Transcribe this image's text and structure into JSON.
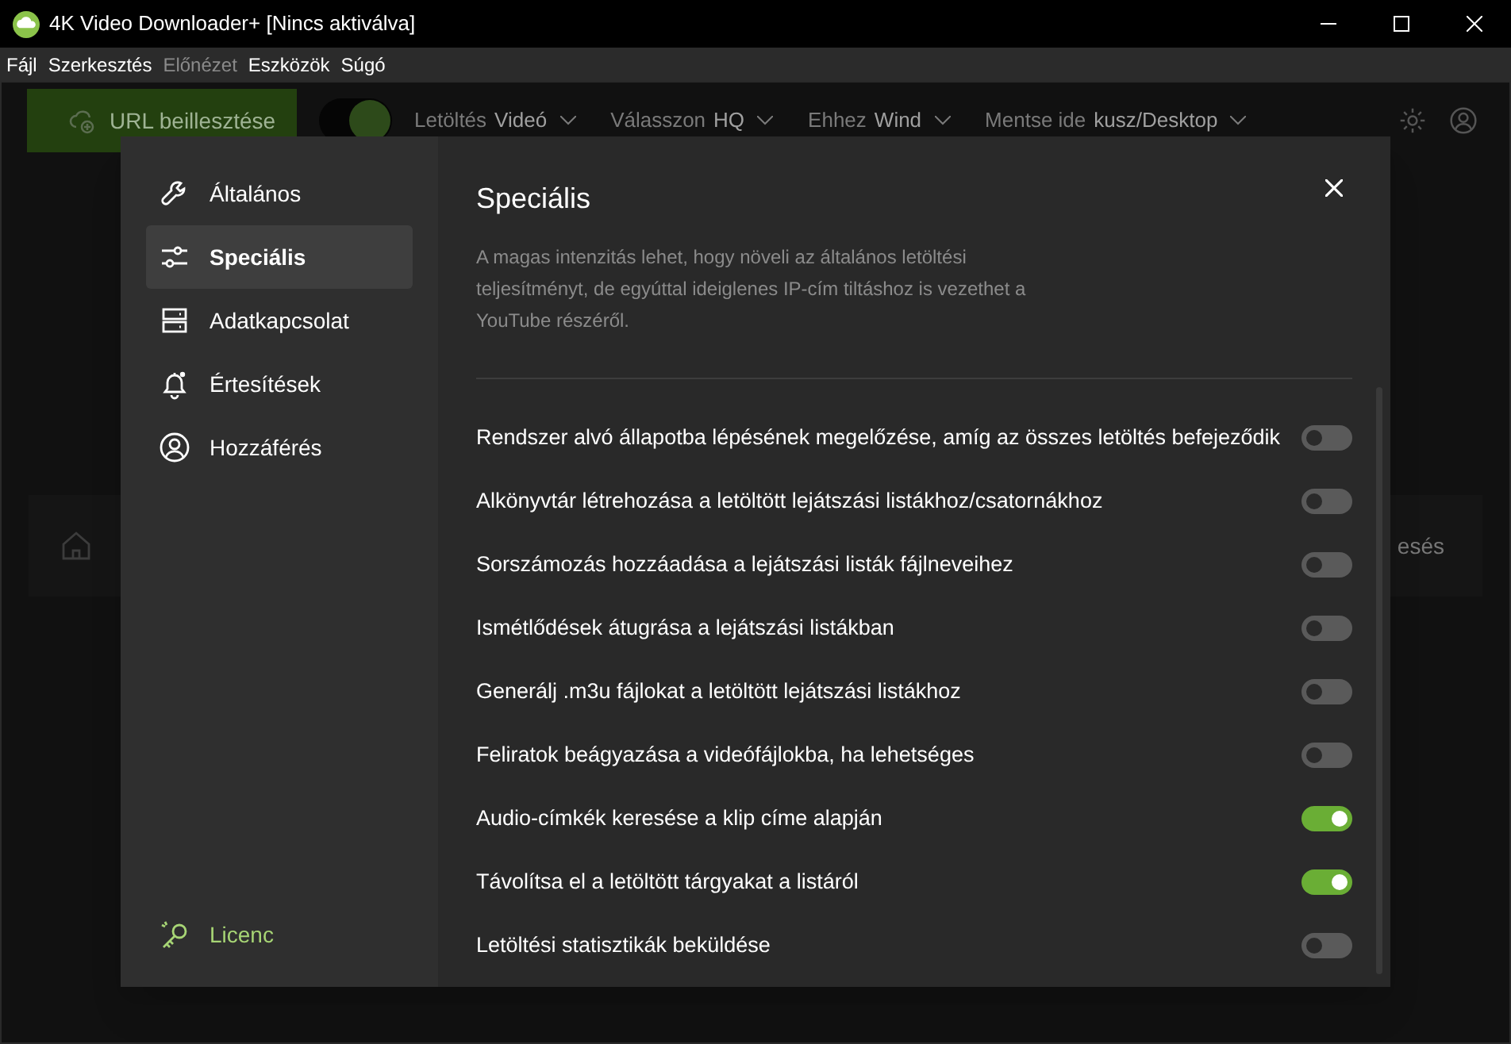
{
  "window": {
    "title": "4K Video Downloader+ [Nincs aktiválva]"
  },
  "menu": [
    {
      "label": "Fájl",
      "disabled": false
    },
    {
      "label": "Szerkesztés",
      "disabled": false
    },
    {
      "label": "Előnézet",
      "disabled": true
    },
    {
      "label": "Eszközök",
      "disabled": false
    },
    {
      "label": "Súgó",
      "disabled": false
    }
  ],
  "toolbar": {
    "paste_button": "URL beillesztése",
    "smart_mode": {
      "on": true
    },
    "options": [
      {
        "label": "Letöltés",
        "value": "Videó"
      },
      {
        "label": "Válasszon",
        "value": "HQ"
      },
      {
        "label": "Ehhez",
        "value": "Wind"
      },
      {
        "label": "Mentse ide",
        "value": "kusz/Desktop"
      }
    ]
  },
  "background_panel": {
    "text": "esés"
  },
  "dialog": {
    "sidebar": {
      "items": [
        {
          "kind": "wrench",
          "label": "Általános",
          "selected": false
        },
        {
          "kind": "sliders",
          "label": "Speciális",
          "selected": true
        },
        {
          "kind": "storage",
          "label": "Adatkapcsolat",
          "selected": false
        },
        {
          "kind": "bell",
          "label": "Értesítések",
          "selected": false
        },
        {
          "kind": "user",
          "label": "Hozzáférés",
          "selected": false
        }
      ],
      "license": "Licenc"
    },
    "title": "Speciális",
    "description": "A magas intenzitás lehet, hogy növeli az általános letöltési teljesítményt, de egyúttal ideiglenes IP-cím tiltáshoz is vezethet a YouTube részéről.",
    "settings": [
      {
        "label": "Rendszer alvó állapotba lépésének megelőzése, amíg az összes letöltés befejeződik",
        "on": false
      },
      {
        "label": "Alkönyvtár létrehozása a letöltött lejátszási listákhoz/csatornákhoz",
        "on": false
      },
      {
        "label": "Sorszámozás hozzáadása a lejátszási listák fájlneveihez",
        "on": false
      },
      {
        "label": "Ismétlődések átugrása a lejátszási listákban",
        "on": false
      },
      {
        "label": "Generálj .m3u fájlokat a letöltött lejátszási listákhoz",
        "on": false
      },
      {
        "label": "Feliratok beágyazása a videófájlokba, ha lehetséges",
        "on": false
      },
      {
        "label": "Audio-címkék keresése a klip címe alapján",
        "on": true
      },
      {
        "label": "Távolítsa el a letöltött tárgyakat a listáról",
        "on": true
      },
      {
        "label": "Letöltési statisztikák beküldése",
        "on": false
      }
    ]
  }
}
